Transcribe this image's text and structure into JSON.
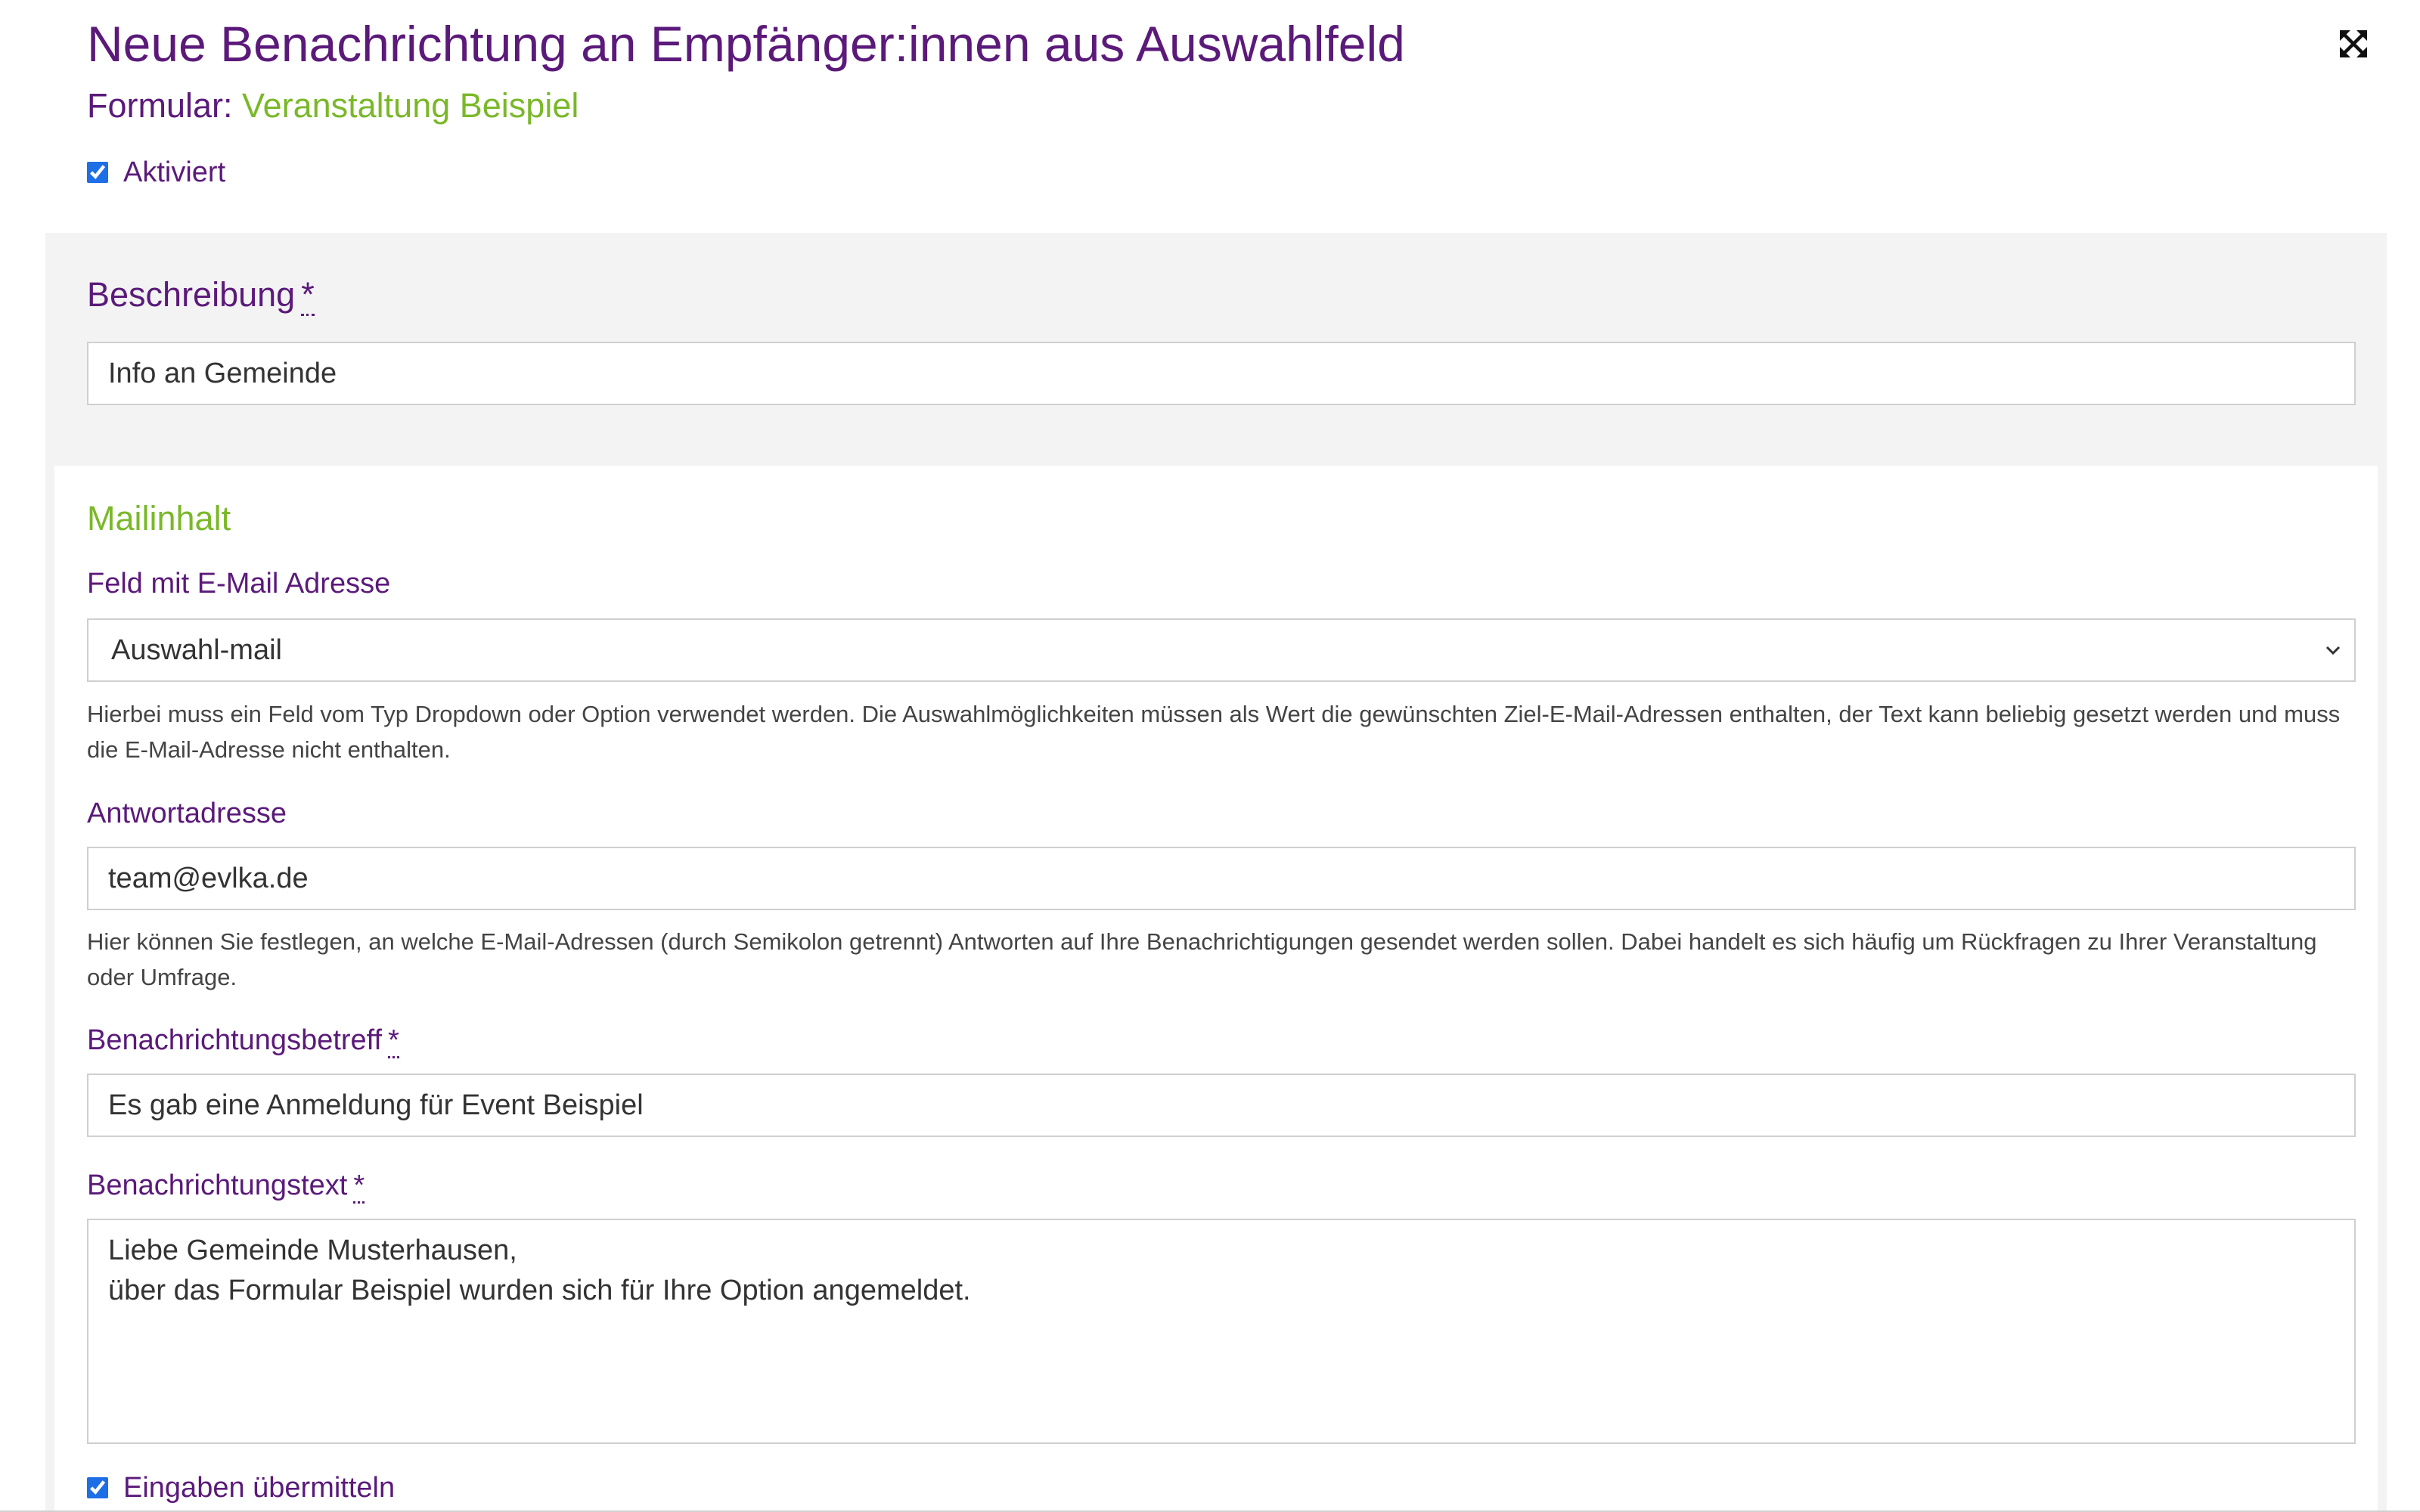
{
  "modal": {
    "title": "Neue Benachrichtung an Empfänger:innen aus Auswahlfeld",
    "subtitle_prefix": "Formular:",
    "form_name": "Veranstaltung Beispiel",
    "activated_label": "Aktiviert",
    "activated_checked": true
  },
  "description": {
    "label": "Beschreibung",
    "required_mark": "*",
    "value": "Info an Gemeinde"
  },
  "mail_content": {
    "heading": "Mailinhalt",
    "email_field": {
      "label": "Feld mit E-Mail Adresse",
      "selected": "Auswahl-mail",
      "help": "Hierbei muss ein Feld vom Typ Dropdown oder Option verwendet werden. Die Auswahlmöglichkeiten müssen als Wert die gewünschten Ziel-E-Mail-Adressen enthalten, der Text kann beliebig gesetzt werden und muss die E-Mail-Adresse nicht enthalten."
    },
    "reply_address": {
      "label": "Antwortadresse",
      "value": "team@evlka.de",
      "help": "Hier können Sie festlegen, an welche E-Mail-Adressen (durch Semikolon getrennt) Antworten auf Ihre Benachrichtigungen gesendet werden sollen. Dabei handelt es sich häufig um Rückfragen zu Ihrer Veranstaltung oder Umfrage."
    },
    "subject": {
      "label": "Benachrichtungsbetreff",
      "required_mark": "*",
      "value": "Es gab eine Anmeldung für Event Beispiel"
    },
    "body": {
      "label": "Benachrichtungstext",
      "required_mark": "*",
      "value": "Liebe Gemeinde Musterhausen,\nüber das Formular Beispiel wurden sich für Ihre Option angemeldet."
    },
    "submit_inputs": {
      "label": "Eingaben übermitteln",
      "checked": true
    }
  },
  "colors": {
    "purple": "#5b1a7a",
    "green": "#7ab829",
    "panel_gray": "#f3f3f3",
    "checkbox_blue": "#1e6ee6"
  },
  "icons": {
    "close": "expand-arrows-icon",
    "dropdown": "chevron-down-icon"
  }
}
